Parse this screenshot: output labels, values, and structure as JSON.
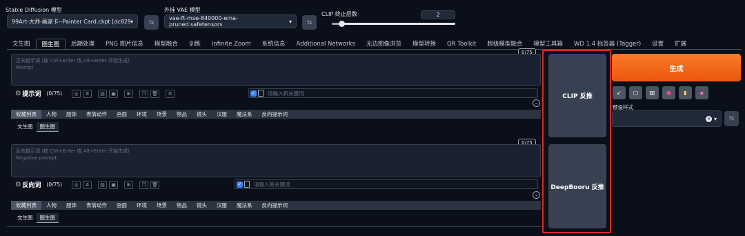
{
  "model": {
    "label": "Stable Diffusion 模型",
    "value": "99Art-大师-画家卡--Painter Card.ckpt [dc82978"
  },
  "vae": {
    "label": "外挂 VAE 模型",
    "value": "vae-ft-mse-840000-ema-pruned.safetensors"
  },
  "clip": {
    "label": "CLIP 终止层数",
    "value": "2",
    "fill_fraction": 0.08
  },
  "tabs": [
    "文生图",
    "图生图",
    "后期处理",
    "PNG 图片信息",
    "模型融合",
    "训练",
    "Infinite Zoom",
    "系统信息",
    "Additional Networks",
    "无边图像浏览",
    "模型转换",
    "QR Toolkit",
    "超级模型融合",
    "模型工具箱",
    "WD 1.4 标签器 (Tagger)",
    "设置",
    "扩展"
  ],
  "active_tab": 1,
  "positive": {
    "placeholder1": "正向提示词 (按 Ctrl+Enter 或 Alt+Enter 开始生成)",
    "placeholder2": "Prompt",
    "counter": "0/75",
    "section_label": "提示词",
    "section_count": "(0/75)",
    "keyword_placeholder": "请输入新关键词"
  },
  "negative": {
    "placeholder1": "反向提示词 (按 Ctrl+Enter 或 Alt+Enter 开始生成)",
    "placeholder2": "Negative prompt",
    "counter": "0/75",
    "section_label": "反向词",
    "section_count": "(0/75)",
    "keyword_placeholder": "请输入新关键词"
  },
  "categories": [
    "收藏列表",
    "人物",
    "服饰",
    "表情动作",
    "画面",
    "环境",
    "场景",
    "物品",
    "镜头",
    "汉服",
    "魔法系",
    "反向提示词"
  ],
  "subtabs": [
    "文生图",
    "图生图"
  ],
  "clip_button": "CLIP 反推",
  "deepbooru_button": "DeepBooru 反推",
  "generate_button": "生成",
  "preset_label": "预设样式",
  "colors": {
    "accent": "#f97316",
    "highlight": "#dc2626"
  }
}
